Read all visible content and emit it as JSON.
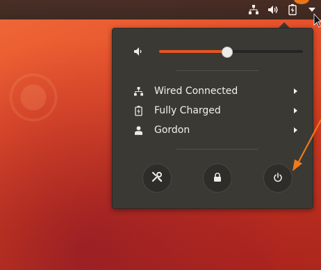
{
  "topbar": {
    "icons": [
      "network-icon",
      "speaker-icon",
      "battery-icon",
      "menu-arrow-icon"
    ]
  },
  "system_menu": {
    "volume": {
      "level": 0.47,
      "icon": "speaker-low-icon"
    },
    "items": [
      {
        "label": "Wired Connected",
        "icon": "network-icon"
      },
      {
        "label": "Fully Charged",
        "icon": "battery-icon"
      },
      {
        "label": "Gordon",
        "icon": "user-icon"
      }
    ],
    "buttons": [
      {
        "icon": "settings-icon"
      },
      {
        "icon": "lock-icon"
      },
      {
        "icon": "power-icon"
      }
    ]
  },
  "colors": {
    "accent": "#e95420",
    "menu_bg": "#3b3934",
    "annotation": "#f07a1a"
  }
}
